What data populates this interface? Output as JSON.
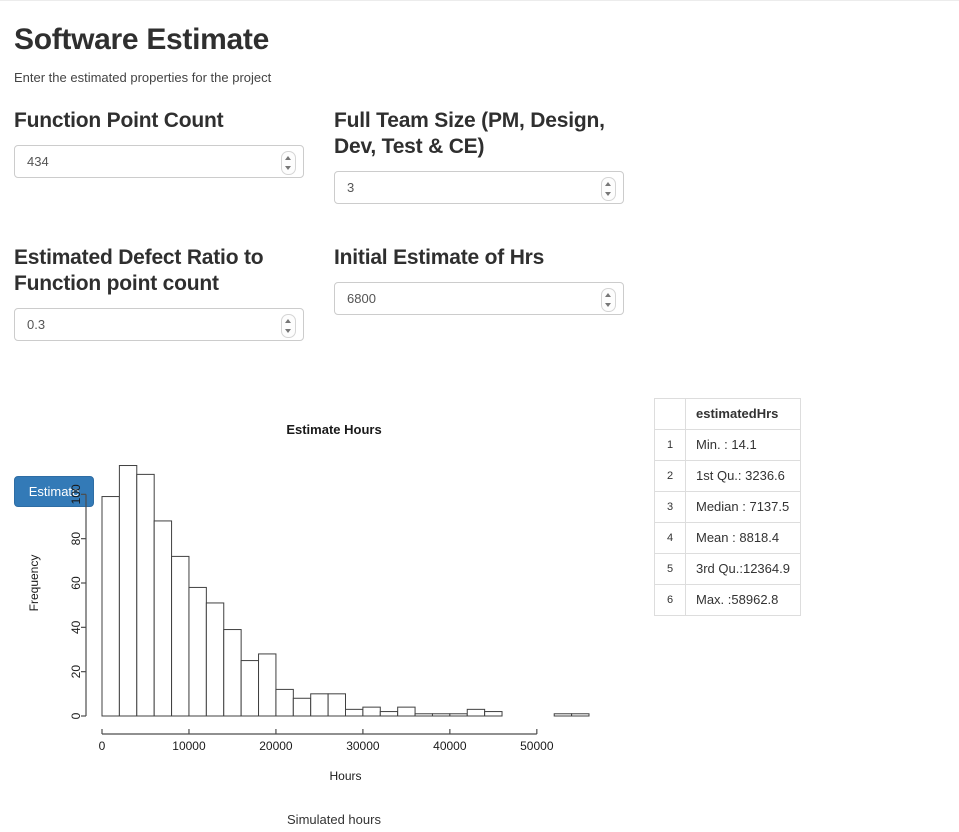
{
  "header": {
    "title": "Software Estimate",
    "subtitle": "Enter the estimated properties for the project"
  },
  "form": {
    "fields": [
      {
        "label": "Function Point Count",
        "value": "434"
      },
      {
        "label": "Full Team Size (PM, Design, Dev, Test & CE)",
        "value": "3"
      },
      {
        "label": "Estimated Defect Ratio to Function point count",
        "value": "0.3"
      },
      {
        "label": "Initial Estimate of Hrs",
        "value": "6800"
      }
    ],
    "submit_label": "Estimate"
  },
  "caption": "Simulated hours",
  "summary": {
    "corner_header": "",
    "column_header": "estimatedHrs",
    "rows": [
      {
        "n": "1",
        "text": "Min. : 14.1"
      },
      {
        "n": "2",
        "text": "1st Qu.: 3236.6"
      },
      {
        "n": "3",
        "text": "Median : 7137.5"
      },
      {
        "n": "4",
        "text": "Mean : 8818.4"
      },
      {
        "n": "5",
        "text": "3rd Qu.:12364.9"
      },
      {
        "n": "6",
        "text": "Max. :58962.8"
      }
    ]
  },
  "colors": {
    "primary": "#337ab7",
    "primary_border": "#2e6da4",
    "text": "#333333",
    "border": "#cccccc",
    "table_border": "#dddddd"
  },
  "chart_data": {
    "type": "bar",
    "title": "Estimate Hours",
    "xlabel": "Hours",
    "ylabel": "Frequency",
    "bin_width": 2000,
    "x_start": 0,
    "xlim": [
      0,
      60000
    ],
    "ylim": [
      0,
      120
    ],
    "xticks": [
      0,
      10000,
      20000,
      30000,
      40000,
      50000
    ],
    "yticks": [
      0,
      20,
      40,
      60,
      80,
      100
    ],
    "grid": false,
    "legend": "none",
    "bin_starts": [
      0,
      2000,
      4000,
      6000,
      8000,
      10000,
      12000,
      14000,
      16000,
      18000,
      20000,
      22000,
      24000,
      26000,
      28000,
      30000,
      32000,
      34000,
      36000,
      38000,
      40000,
      42000,
      44000,
      46000,
      48000,
      50000,
      52000,
      54000,
      56000,
      58000
    ],
    "categories": [
      "0-2000",
      "2000-4000",
      "4000-6000",
      "6000-8000",
      "8000-10000",
      "10000-12000",
      "12000-14000",
      "14000-16000",
      "16000-18000",
      "18000-20000",
      "20000-22000",
      "22000-24000",
      "24000-26000",
      "26000-28000",
      "28000-30000",
      "30000-32000",
      "32000-34000",
      "34000-36000",
      "36000-38000",
      "38000-40000",
      "40000-42000",
      "42000-44000",
      "44000-46000",
      "46000-48000",
      "48000-50000",
      "50000-52000",
      "52000-54000",
      "54000-56000",
      "56000-58000",
      "58000-60000"
    ],
    "values": [
      99,
      113,
      109,
      88,
      72,
      58,
      51,
      39,
      25,
      28,
      12,
      8,
      10,
      10,
      3,
      4,
      2,
      4,
      1,
      1,
      1,
      3,
      2,
      0,
      0,
      0,
      1,
      1,
      0,
      0
    ]
  }
}
